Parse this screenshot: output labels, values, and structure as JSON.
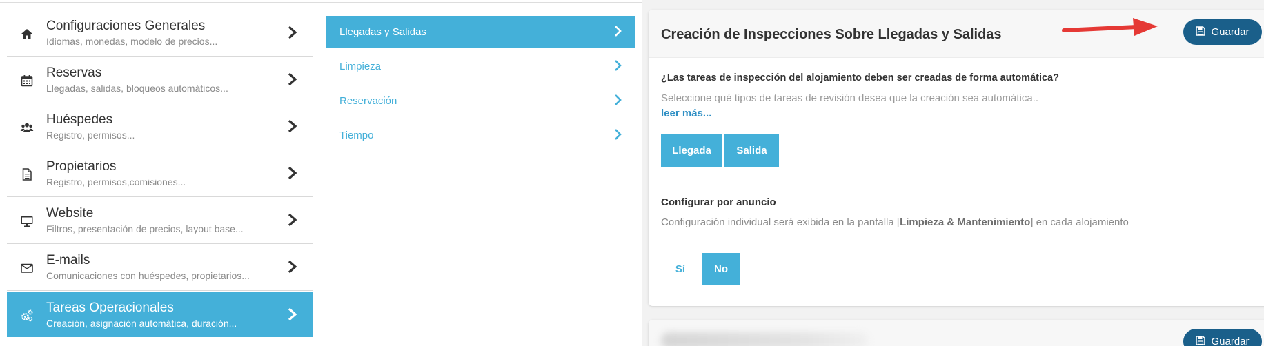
{
  "sidebar": {
    "items": [
      {
        "title": "Configuraciones Generales",
        "subtitle": "Idiomas, monedas, modelo de precios...",
        "icon": "home-icon"
      },
      {
        "title": "Reservas",
        "subtitle": "Llegadas, salidas, bloqueos automáticos...",
        "icon": "calendar-icon"
      },
      {
        "title": "Huéspedes",
        "subtitle": "Registro, permisos...",
        "icon": "users-icon"
      },
      {
        "title": "Propietarios",
        "subtitle": "Registro, permisos,comisiones...",
        "icon": "document-icon"
      },
      {
        "title": "Website",
        "subtitle": "Filtros, presentación de precios, layout base...",
        "icon": "monitor-icon"
      },
      {
        "title": "E-mails",
        "subtitle": "Comunicaciones con huéspedes, propietarios...",
        "icon": "envelope-icon"
      },
      {
        "title": "Tareas Operacionales",
        "subtitle": "Creación, asignación automática, duración...",
        "icon": "gears-icon",
        "active": true
      }
    ]
  },
  "submenu": {
    "items": [
      {
        "label": "Llegadas y Salidas",
        "active": true
      },
      {
        "label": "Limpieza"
      },
      {
        "label": "Reservación"
      },
      {
        "label": "Tiempo"
      }
    ]
  },
  "card": {
    "title": "Creación de Inspecciones Sobre Llegadas y Salidas",
    "save_label": "Guardar",
    "question1": "¿Las tareas de inspección del alojamiento deben ser creadas de forma automática?",
    "description1": "Seleccione qué tipos de tareas de revisión desea que la creación sea automática..",
    "read_more": "leer más...",
    "option_arrival": "Llegada",
    "option_departure": "Salida",
    "question2": "Configurar por anuncio",
    "description2_prefix": "Configuración individual será exibida en la pantalla [",
    "description2_bold": "Limpieza & Mantenimiento",
    "description2_suffix": "] en cada alojamiento",
    "yes_label": "Sí",
    "no_label": "No"
  },
  "card2": {
    "save_label": "Guardar"
  },
  "colors": {
    "accent": "#44b0d9",
    "save_button": "#1a5f8a",
    "arrow": "#e53935"
  }
}
